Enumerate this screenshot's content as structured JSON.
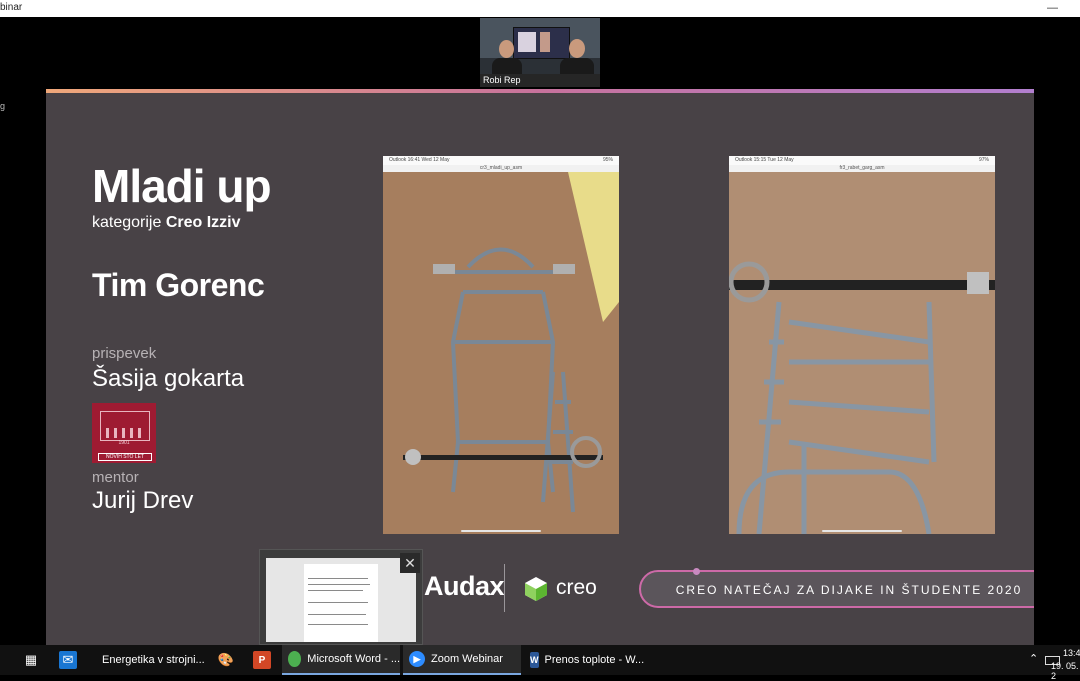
{
  "window": {
    "title": "binar"
  },
  "sidebar_mark": "g",
  "participant": {
    "name": "Robi Rep"
  },
  "slide": {
    "heading": "Mladi up",
    "category_prefix": "kategorije",
    "category_name": "Creo Izziv",
    "team": "Tim Gorenc",
    "contribution_label": "prispevek",
    "contribution_title": "Šasija gokarta",
    "school_logo": {
      "year": "1901",
      "motto": "NOVIH STO LET"
    },
    "mentor_label": "mentor",
    "mentor_name": "Jurij Drev",
    "tablet_left": {
      "status_left": "Outlook 16:41 Wed 12 May",
      "status_right": "95%",
      "url": "cr3_mladi_up_asm"
    },
    "tablet_right": {
      "status_left": "Outlook 15:15 Tue 12 May",
      "status_right": "97%",
      "url": "fr3_rabet_garg_asm"
    },
    "brand_audax": "Audax",
    "brand_creo": "creo",
    "contest_banner": "CREO NATEČAJ ZA DIJAKE IN ŠTUDENTE 2020"
  },
  "taskbar": {
    "items": [
      {
        "label": "Energetika v strojni...",
        "icon_color": "#f2c94c"
      },
      {
        "label": "Microsoft Word - ...",
        "icon_color": "#4caf50"
      },
      {
        "label": "Zoom Webinar",
        "icon_color": "#2d8cff"
      },
      {
        "label": "Prenos toplote - W...",
        "icon_color": "#2b5797"
      }
    ],
    "clock": {
      "time": "13:4",
      "date": "19. 05. 2"
    }
  },
  "colors": {
    "slide_bg": "#484246",
    "accent": "#cd6aa8",
    "taskbar": "#111111"
  }
}
